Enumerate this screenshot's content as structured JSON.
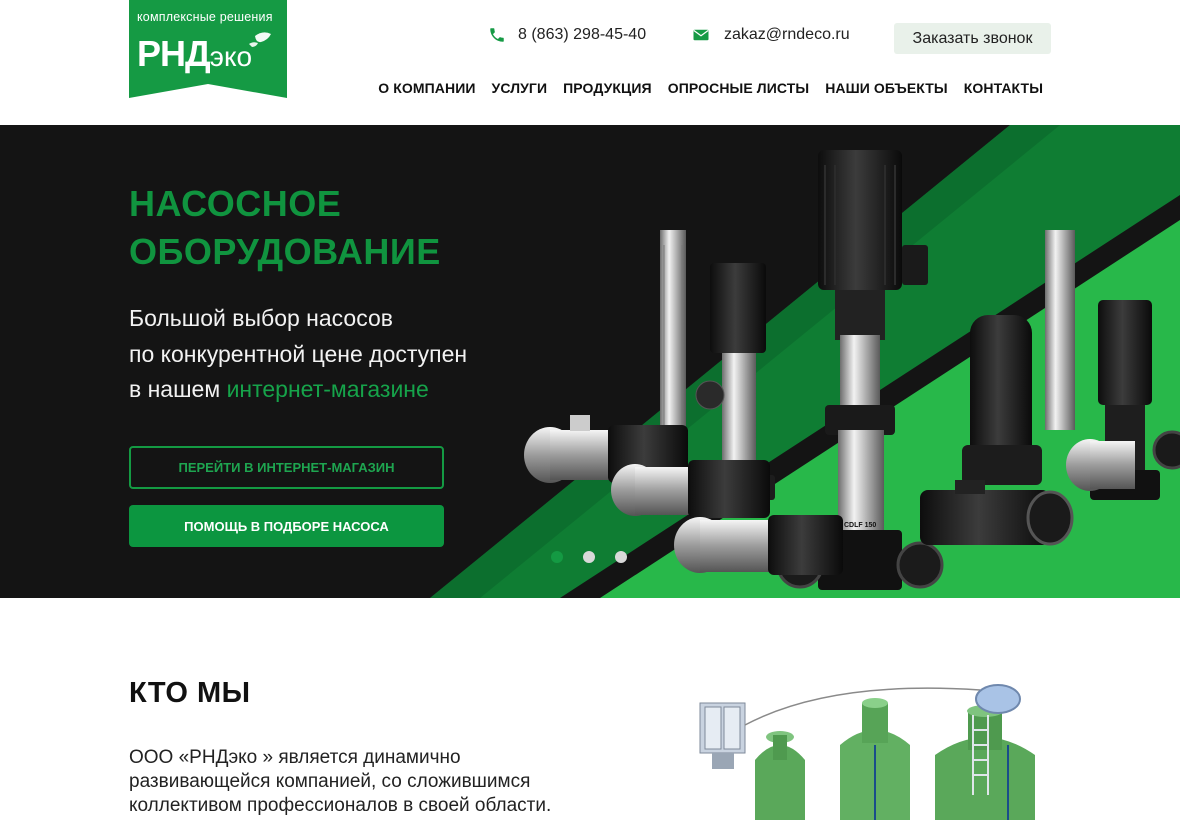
{
  "logo": {
    "tagline": "комплексные решения",
    "name_main": "РНД",
    "name_sub": "эко",
    "bg_color": "#159a44"
  },
  "header": {
    "phone": "8 (863) 298-45-40",
    "email": "zakaz@rndeco.ru",
    "callback_label": "Заказать звонок",
    "phone_icon": "phone-icon",
    "email_icon": "envelope-icon"
  },
  "nav": {
    "items": [
      {
        "label": "О КОМПАНИИ"
      },
      {
        "label": "УСЛУГИ"
      },
      {
        "label": "ПРОДУКЦИЯ"
      },
      {
        "label": "ОПРОСНЫЕ ЛИСТЫ"
      },
      {
        "label": "НАШИ ОБЪЕКТЫ"
      },
      {
        "label": "КОНТАКТЫ"
      }
    ]
  },
  "hero": {
    "title_line1": "НАСОСНОЕ",
    "title_line2": "ОБОРУДОВАНИЕ",
    "subtitle_line1": "Большой выбор насосов",
    "subtitle_line2": "по конкурентной цене доступен",
    "subtitle_line3_prefix": "в нашем ",
    "subtitle_line3_link": "интернет-магазине",
    "btn_shop": "ПЕРЕЙТИ В ИНТЕРНЕТ-МАГАЗИН",
    "btn_help": "ПОМОЩЬ В ПОДБОРЕ НАСОСА",
    "pump_label": "CDLF 150",
    "slides_total": 3,
    "slide_active": 1,
    "accent_color": "#149a43"
  },
  "about": {
    "title": "КТО МЫ",
    "text_line1": "ООО «РНДэко » является динамично",
    "text_line2": "развивающейся компанией, со сложившимся",
    "text_line3": "коллективом профессионалов в своей области."
  }
}
